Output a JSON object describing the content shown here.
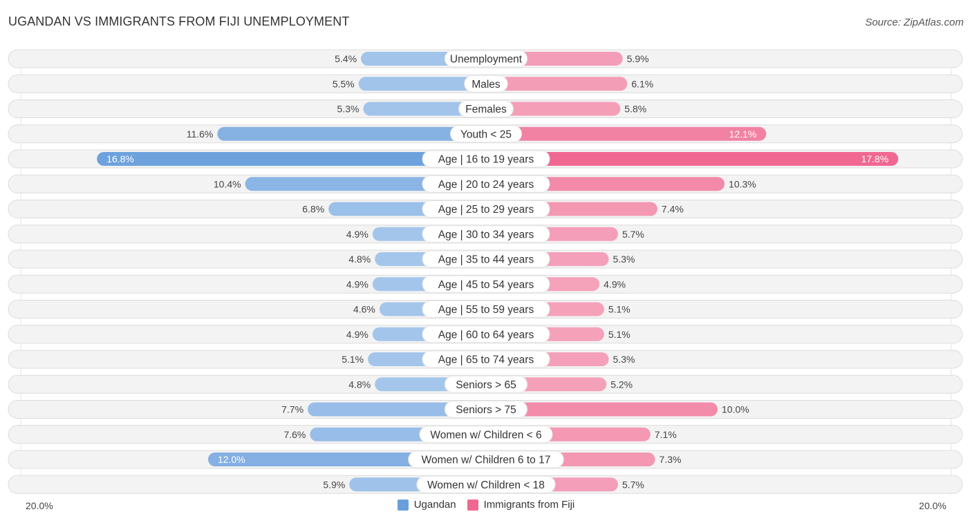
{
  "header": {
    "title": "UGANDAN VS IMMIGRANTS FROM FIJI UNEMPLOYMENT",
    "source": "Source: ZipAtlas.com"
  },
  "colors": {
    "ugandan": "#6a9fdc",
    "ugandan_light": "#a8c8ec",
    "fiji": "#f06892",
    "fiji_light": "#f5a6be"
  },
  "axis": {
    "left_label": "20.0%",
    "right_label": "20.0%"
  },
  "legend": [
    {
      "label": "Ugandan",
      "color": "#6a9fdc"
    },
    {
      "label": "Immigrants from Fiji",
      "color": "#f06892"
    }
  ],
  "chart_data": {
    "type": "bar",
    "orientation": "horizontal-diverging",
    "title": "UGANDAN VS IMMIGRANTS FROM FIJI UNEMPLOYMENT",
    "xlim": [
      0,
      20
    ],
    "x_unit": "%",
    "legend_position": "bottom-center",
    "categories": [
      "Unemployment",
      "Males",
      "Females",
      "Youth < 25",
      "Age | 16 to 19 years",
      "Age | 20 to 24 years",
      "Age | 25 to 29 years",
      "Age | 30 to 34 years",
      "Age | 35 to 44 years",
      "Age | 45 to 54 years",
      "Age | 55 to 59 years",
      "Age | 60 to 64 years",
      "Age | 65 to 74 years",
      "Seniors > 65",
      "Seniors > 75",
      "Women w/ Children < 6",
      "Women w/ Children 6 to 17",
      "Women w/ Children < 18"
    ],
    "series": [
      {
        "name": "Ugandan",
        "values": [
          5.4,
          5.5,
          5.3,
          11.6,
          16.8,
          10.4,
          6.8,
          4.9,
          4.8,
          4.9,
          4.6,
          4.9,
          5.1,
          4.8,
          7.7,
          7.6,
          12.0,
          5.9
        ],
        "labels": [
          "5.4%",
          "5.5%",
          "5.3%",
          "11.6%",
          "16.8%",
          "10.4%",
          "6.8%",
          "4.9%",
          "4.8%",
          "4.9%",
          "4.6%",
          "4.9%",
          "5.1%",
          "4.8%",
          "7.7%",
          "7.6%",
          "12.0%",
          "5.9%"
        ]
      },
      {
        "name": "Immigrants from Fiji",
        "values": [
          5.9,
          6.1,
          5.8,
          12.1,
          17.8,
          10.3,
          7.4,
          5.7,
          5.3,
          4.9,
          5.1,
          5.1,
          5.3,
          5.2,
          10.0,
          7.1,
          7.3,
          5.7
        ],
        "labels": [
          "5.9%",
          "6.1%",
          "5.8%",
          "12.1%",
          "17.8%",
          "10.3%",
          "7.4%",
          "5.7%",
          "5.3%",
          "4.9%",
          "5.1%",
          "5.1%",
          "5.3%",
          "5.2%",
          "10.0%",
          "7.1%",
          "7.3%",
          "5.7%"
        ]
      }
    ]
  }
}
